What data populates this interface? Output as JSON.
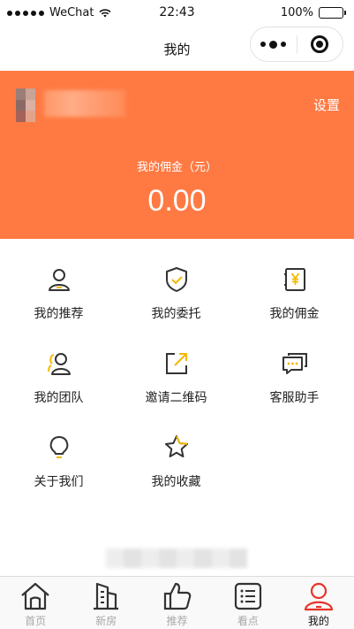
{
  "status_bar": {
    "carrier": "WeChat",
    "time": "22:43",
    "battery": "100%"
  },
  "nav": {
    "title": "我的"
  },
  "header": {
    "settings_label": "设置",
    "commission_label": "我的佣金（元）",
    "commission_value": "0.00",
    "background_color": "#ff7a43"
  },
  "menu": [
    {
      "label": "我的推荐",
      "icon": "user-icon"
    },
    {
      "label": "我的委托",
      "icon": "shield-check-icon"
    },
    {
      "label": "我的佣金",
      "icon": "yuan-icon"
    },
    {
      "label": "我的团队",
      "icon": "team-icon"
    },
    {
      "label": "邀请二维码",
      "icon": "share-edit-icon"
    },
    {
      "label": "客服助手",
      "icon": "chat-bubbles-icon"
    },
    {
      "label": "关于我们",
      "icon": "lightbulb-icon"
    },
    {
      "label": "我的收藏",
      "icon": "star-icon"
    }
  ],
  "tabs": [
    {
      "label": "首页",
      "icon": "home-icon",
      "active": false
    },
    {
      "label": "新房",
      "icon": "building-icon",
      "active": false
    },
    {
      "label": "推荐",
      "icon": "thumbs-up-icon",
      "active": false
    },
    {
      "label": "看点",
      "icon": "list-icon",
      "active": false
    },
    {
      "label": "我的",
      "icon": "profile-icon",
      "active": true
    }
  ],
  "colors": {
    "accent": "#ff7a43",
    "icon_accent": "#f5b800",
    "active_tab": "#e8332a"
  }
}
